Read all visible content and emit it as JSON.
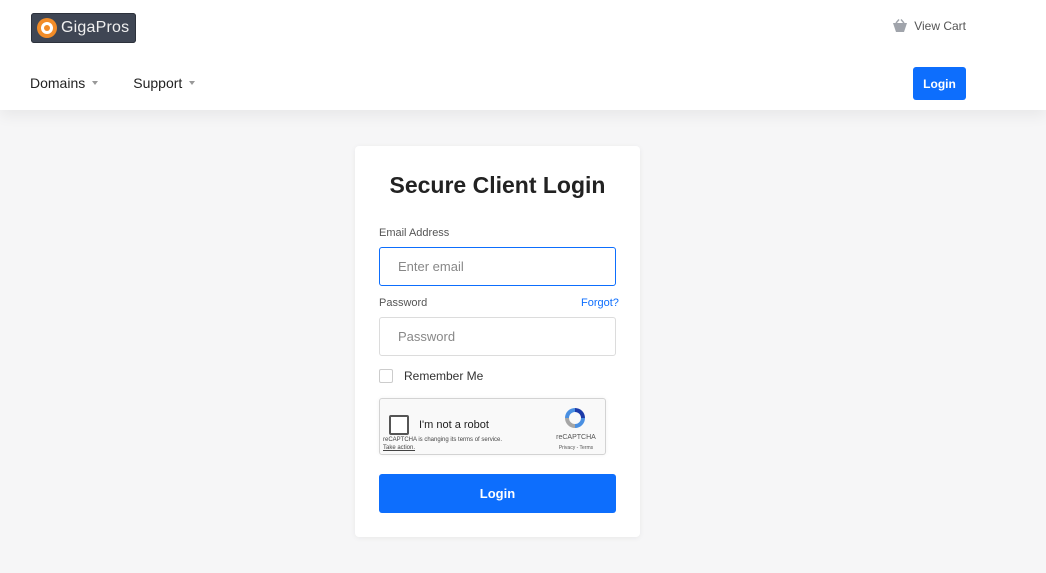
{
  "header": {
    "logo_text": "GigaPros",
    "view_cart_label": "View Cart",
    "nav": [
      {
        "label": "Domains"
      },
      {
        "label": "Support"
      }
    ],
    "login_label": "Login"
  },
  "login_card": {
    "title": "Secure Client Login",
    "email_label": "Email Address",
    "email_placeholder": "Enter email",
    "email_value": "",
    "password_label": "Password",
    "forgot_label": "Forgot?",
    "password_placeholder": "Password",
    "password_value": "",
    "remember_label": "Remember Me",
    "remember_checked": false,
    "captcha": {
      "label": "I'm not a robot",
      "notice": "reCAPTCHA is changing its terms of service.",
      "notice_link": "Take action.",
      "brand": "reCAPTCHA",
      "links": "Privacy - Terms"
    },
    "submit_label": "Login"
  },
  "colors": {
    "primary": "#0d6efd",
    "page_bg": "#f6f6f7",
    "logo_bg": "#3f4654",
    "logo_accent": "#f28c28"
  },
  "icons": {
    "cart": "basket-icon",
    "captcha": "recaptcha-icon",
    "dropdown": "caret-down-icon"
  }
}
